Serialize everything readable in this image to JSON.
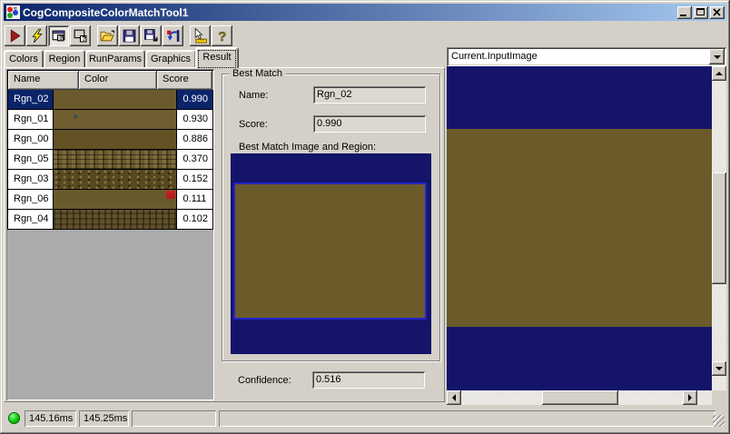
{
  "window": {
    "title": "CogCompositeColorMatchTool1"
  },
  "titlebar": {
    "buttons": [
      "minimize",
      "maximize",
      "close"
    ]
  },
  "toolbar": {
    "buttons": [
      {
        "name": "run",
        "icon": "run-icon"
      },
      {
        "name": "electric-run",
        "icon": "lightning-icon"
      },
      {
        "name": "show-result-window",
        "icon": "result-window-icon",
        "pressed": true
      },
      {
        "name": "float-result-window",
        "icon": "float-window-icon",
        "pressed": false
      },
      {
        "name": "open",
        "icon": "open-folder-icon"
      },
      {
        "name": "save",
        "icon": "save-icon"
      },
      {
        "name": "save-as",
        "icon": "save-as-icon"
      },
      {
        "name": "reset",
        "icon": "reset-icon"
      },
      {
        "name": "pointer-tool",
        "icon": "pointer-ruler-icon"
      },
      {
        "name": "help",
        "icon": "help-icon"
      }
    ]
  },
  "tabs": {
    "items": [
      "Colors",
      "Region",
      "RunParams",
      "Graphics",
      "Result"
    ],
    "selected": "Result"
  },
  "results_table": {
    "columns": [
      "Name",
      "Color",
      "Score"
    ],
    "selected_row": "Rgn_02",
    "rows": [
      {
        "name": "Rgn_02",
        "score": "0.990",
        "swatch": "rgn02",
        "selected": true
      },
      {
        "name": "Rgn_01",
        "score": "0.930",
        "swatch": "rgn01",
        "selected": false
      },
      {
        "name": "Rgn_00",
        "score": "0.886",
        "swatch": "rgn00",
        "selected": false
      },
      {
        "name": "Rgn_05",
        "score": "0.370",
        "swatch": "rgn05",
        "selected": false
      },
      {
        "name": "Rgn_03",
        "score": "0.152",
        "swatch": "rgn03",
        "selected": false
      },
      {
        "name": "Rgn_06",
        "score": "0.111",
        "swatch": "rgn06",
        "selected": false
      },
      {
        "name": "Rgn_04",
        "score": "0.102",
        "swatch": "rgn04",
        "selected": false
      }
    ]
  },
  "best_match": {
    "group_title": "Best Match",
    "name_label": "Name:",
    "name_value": "Rgn_02",
    "score_label": "Score:",
    "score_value": "0.990",
    "image_caption": "Best Match Image and Region:",
    "confidence_label": "Confidence:",
    "confidence_value": "0.516"
  },
  "image_selector": {
    "value": "Current.InputImage"
  },
  "status_bar": {
    "time1": "145.16ms",
    "time2": "145.25ms"
  },
  "colors": {
    "titlebar_left": "#0a246a",
    "titlebar_right": "#a6caf0",
    "selection": "#0a246a",
    "image_background": "#14146b",
    "match_brown": "#6b5b2b",
    "region_outline": "#2323c8",
    "status_indicator": "#00c800",
    "window_face": "#d4d0c8"
  }
}
